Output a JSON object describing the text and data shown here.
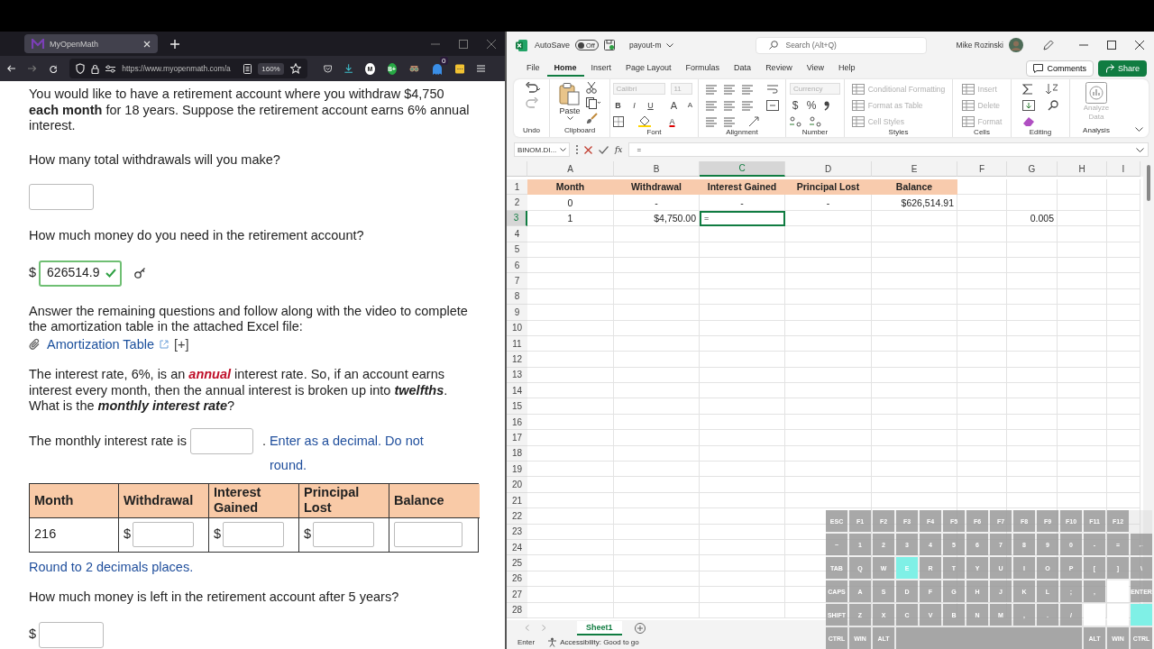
{
  "browser": {
    "tab": {
      "title": "MyOpenMath",
      "selected": true
    },
    "url": "https://www.myopenmath.com/a",
    "zoom": "160%",
    "extensions": [
      "M",
      "B+"
    ],
    "notification_count": "0"
  },
  "problem": [
    {
      "kind": "paragraph",
      "text": "You would like to have a retirement account where you withdraw $4,750 **each month** for 18 years. Suppose the retirement account earns 6% annual interest."
    },
    {
      "kind": "question",
      "text": "How many total withdrawals will you make?"
    },
    {
      "kind": "answer",
      "correct": false
    },
    {
      "kind": "question",
      "text": "How much money do you need in the retirement account?"
    },
    {
      "kind": "answer",
      "prefix": "$",
      "value": "626514.9",
      "correct": true
    },
    {
      "kind": "paragraph",
      "text": "Answer the remaining questions and follow along with the video to complete the amortization table in the attached Excel file:"
    },
    {
      "kind": "attachment",
      "link": "Amortization Table",
      "more": "[+]"
    },
    {
      "kind": "segments",
      "segments": [
        {
          "text": "The interest rate, 6%, is an ",
          "kind": "plain"
        },
        {
          "text": "annual",
          "kind": "alert"
        },
        {
          "text": " interest rate. So, if an account earns interest every month, then the annual interest is broken up into ",
          "kind": "plain"
        },
        {
          "text": "twelfths",
          "kind": "emphasis"
        },
        {
          "text": ".  What is the ",
          "kind": "plain"
        },
        {
          "text": "monthly interest rate",
          "kind": "emphasis"
        },
        {
          "text": "?",
          "kind": "plain"
        }
      ]
    },
    {
      "kind": "fill-in",
      "before": "The monthly interest rate is",
      "after": ".",
      "hint": "Enter as a decimal. Do not round."
    },
    {
      "kind": "table",
      "columns": [
        "Month",
        "Withdrawal",
        "Interest Gained",
        "Principal Lost",
        "Balance"
      ],
      "rows": [
        [
          {
            "kind": "text",
            "text": "216"
          },
          {
            "kind": "input",
            "prefix": "$"
          },
          {
            "kind": "input",
            "prefix": "$"
          },
          {
            "kind": "input",
            "prefix": "$"
          },
          {
            "kind": "input"
          }
        ]
      ]
    },
    {
      "kind": "note",
      "text": "Round to 2 decimals places."
    },
    {
      "kind": "question",
      "text": "How much money is left in the retirement account after 5 years?"
    },
    {
      "kind": "answer",
      "prefix": "$",
      "correct": false
    }
  ],
  "excel": {
    "autosave": {
      "label": "AutoSave",
      "on": false,
      "state_text": "Off"
    },
    "file_name": "payout-m",
    "search_placeholder": "Search (Alt+Q)",
    "user": "Mike Rozinski",
    "menu": [
      {
        "label": "File",
        "selected": false
      },
      {
        "label": "Home",
        "selected": true
      },
      {
        "label": "Insert",
        "selected": false
      },
      {
        "label": "Page Layout",
        "selected": false
      },
      {
        "label": "Formulas",
        "selected": false
      },
      {
        "label": "Data",
        "selected": false
      },
      {
        "label": "Review",
        "selected": false
      },
      {
        "label": "View",
        "selected": false
      },
      {
        "label": "Help",
        "selected": false
      }
    ],
    "comments": "Comments",
    "share": "Share",
    "ribbon": [
      {
        "kind": "undo",
        "label": "Undo"
      },
      {
        "kind": "clipboard",
        "label": "Clipboard",
        "items": [
          {
            "text": "Paste",
            "disabled": false
          }
        ]
      },
      {
        "kind": "font",
        "label": "Font",
        "items": [
          {
            "text": "Calibri",
            "disabled": true
          },
          {
            "text": "11",
            "disabled": true
          },
          {
            "text": "B",
            "disabled": false
          },
          {
            "text": "I",
            "disabled": false
          },
          {
            "text": "U",
            "disabled": false
          },
          {
            "text": "A",
            "disabled": false
          },
          {
            "text": "A",
            "disabled": false
          },
          {
            "text": "A",
            "disabled": false
          }
        ]
      },
      {
        "kind": "alignment",
        "label": "Alignment"
      },
      {
        "kind": "number",
        "label": "Number",
        "items": [
          {
            "text": "Currency",
            "disabled": true
          },
          {
            "text": "$",
            "disabled": false
          },
          {
            "text": "%",
            "disabled": false
          }
        ]
      },
      {
        "kind": "styles",
        "label": "Styles",
        "items": [
          {
            "text": "Conditional Formatting",
            "disabled": true
          },
          {
            "text": "Format as Table",
            "disabled": true
          },
          {
            "text": "Cell Styles",
            "disabled": true
          }
        ]
      },
      {
        "kind": "cells",
        "label": "Cells",
        "items": [
          {
            "text": "Insert",
            "disabled": true
          },
          {
            "text": "Delete",
            "disabled": true
          },
          {
            "text": "Format",
            "disabled": true
          }
        ]
      },
      {
        "kind": "editing",
        "label": "Editing"
      },
      {
        "kind": "analysis",
        "label": "Analysis",
        "items": [
          {
            "text": "Analyze Data",
            "disabled": true
          }
        ]
      }
    ],
    "name_box": "BINOM.DI...",
    "fx": "fx",
    "formula": "=",
    "columns": [
      {
        "label": "A",
        "selected": false
      },
      {
        "label": "B",
        "selected": false
      },
      {
        "label": "C",
        "selected": true
      },
      {
        "label": "D",
        "selected": false
      },
      {
        "label": "E",
        "selected": false
      },
      {
        "label": "F",
        "selected": false
      },
      {
        "label": "G",
        "selected": false
      },
      {
        "label": "H",
        "selected": false
      },
      {
        "label": "I",
        "selected": false
      }
    ],
    "rows": [
      {
        "number": "1",
        "selected": false,
        "cells": [
          {
            "kind": "header",
            "text": "Month",
            "selected": false
          },
          {
            "kind": "header",
            "text": "Withdrawal",
            "selected": false
          },
          {
            "kind": "header",
            "text": "Interest Gained",
            "selected": false
          },
          {
            "kind": "header",
            "text": "Principal Lost",
            "selected": false
          },
          {
            "kind": "header",
            "text": "Balance",
            "selected": false
          }
        ]
      },
      {
        "number": "2",
        "selected": false,
        "cells": [
          {
            "kind": "center",
            "text": "0",
            "selected": false
          },
          {
            "kind": "center",
            "text": "-",
            "selected": false
          },
          {
            "kind": "center",
            "text": "-",
            "selected": false
          },
          {
            "kind": "center",
            "text": "-",
            "selected": false
          },
          {
            "kind": "number",
            "text": "$626,514.91",
            "selected": false
          }
        ]
      },
      {
        "number": "3",
        "selected": true,
        "cells": [
          {
            "kind": "center",
            "text": "1",
            "selected": false
          },
          {
            "kind": "number",
            "text": "$4,750.00",
            "selected": false
          },
          {
            "kind": "input",
            "text": "=",
            "selected": true
          },
          {
            "kind": "empty",
            "selected": false
          },
          {
            "kind": "empty",
            "selected": false
          },
          {
            "kind": "empty",
            "selected": false
          },
          {
            "kind": "number",
            "text": "0.005",
            "selected": false
          }
        ]
      },
      {
        "number": "4",
        "selected": false
      },
      {
        "number": "5",
        "selected": false
      },
      {
        "number": "6",
        "selected": false
      },
      {
        "number": "7",
        "selected": false
      },
      {
        "number": "8",
        "selected": false
      },
      {
        "number": "9",
        "selected": false
      },
      {
        "number": "10",
        "selected": false
      },
      {
        "number": "11",
        "selected": false
      },
      {
        "number": "12",
        "selected": false
      },
      {
        "number": "13",
        "selected": false
      },
      {
        "number": "14",
        "selected": false
      },
      {
        "number": "15",
        "selected": false
      },
      {
        "number": "16",
        "selected": false
      },
      {
        "number": "17",
        "selected": false
      },
      {
        "number": "18",
        "selected": false
      },
      {
        "number": "19",
        "selected": false
      },
      {
        "number": "20",
        "selected": false
      },
      {
        "number": "21",
        "selected": false
      },
      {
        "number": "22",
        "selected": false
      },
      {
        "number": "23",
        "selected": false
      },
      {
        "number": "24",
        "selected": false
      },
      {
        "number": "25",
        "selected": false
      },
      {
        "number": "26",
        "selected": false
      },
      {
        "number": "27",
        "selected": false
      },
      {
        "number": "28",
        "selected": false
      }
    ],
    "sheets": [
      {
        "label": "Sheet1",
        "selected": true
      }
    ],
    "status": {
      "mode": "Enter",
      "accessibility": "Accessibility: Good to go"
    }
  },
  "keyboard": [
    [
      {
        "kind": "key",
        "label": "ESC",
        "selected": false
      },
      {
        "kind": "key",
        "label": "F1",
        "selected": false
      },
      {
        "kind": "key",
        "label": "F2",
        "selected": false
      },
      {
        "kind": "key",
        "label": "F3",
        "selected": false
      },
      {
        "kind": "key",
        "label": "F4",
        "selected": false
      },
      {
        "kind": "key",
        "label": "F5",
        "selected": false
      },
      {
        "kind": "key",
        "label": "F6",
        "selected": false
      },
      {
        "kind": "key",
        "label": "F7",
        "selected": false
      },
      {
        "kind": "key",
        "label": "F8",
        "selected": false
      },
      {
        "kind": "key",
        "label": "F9",
        "selected": false
      },
      {
        "kind": "key",
        "label": "F10",
        "selected": false
      },
      {
        "kind": "key",
        "label": "F11",
        "selected": false
      },
      {
        "kind": "key",
        "label": "F12",
        "selected": false
      }
    ],
    [
      {
        "kind": "key",
        "label": "~",
        "selected": false
      },
      {
        "kind": "key",
        "label": "1",
        "selected": false
      },
      {
        "kind": "key",
        "label": "2",
        "selected": false
      },
      {
        "kind": "key",
        "label": "3",
        "selected": false
      },
      {
        "kind": "key",
        "label": "4",
        "selected": false
      },
      {
        "kind": "key",
        "label": "5",
        "selected": false
      },
      {
        "kind": "key",
        "label": "6",
        "selected": false
      },
      {
        "kind": "key",
        "label": "7",
        "selected": false
      },
      {
        "kind": "key",
        "label": "8",
        "selected": false
      },
      {
        "kind": "key",
        "label": "9",
        "selected": false
      },
      {
        "kind": "key",
        "label": "0",
        "selected": false
      },
      {
        "kind": "key",
        "label": "-",
        "selected": false
      },
      {
        "kind": "key",
        "label": "=",
        "selected": false
      },
      {
        "kind": "key",
        "label": "←",
        "selected": false
      }
    ],
    [
      {
        "kind": "key",
        "label": "TAB",
        "selected": false
      },
      {
        "kind": "key",
        "label": "Q",
        "selected": false
      },
      {
        "kind": "key",
        "label": "W",
        "selected": false
      },
      {
        "kind": "key",
        "label": "E",
        "selected": true
      },
      {
        "kind": "key",
        "label": "R",
        "selected": false
      },
      {
        "kind": "key",
        "label": "T",
        "selected": false
      },
      {
        "kind": "key",
        "label": "Y",
        "selected": false
      },
      {
        "kind": "key",
        "label": "U",
        "selected": false
      },
      {
        "kind": "key",
        "label": "I",
        "selected": false
      },
      {
        "kind": "key",
        "label": "O",
        "selected": false
      },
      {
        "kind": "key",
        "label": "P",
        "selected": false
      },
      {
        "kind": "key",
        "label": "[",
        "selected": false
      },
      {
        "kind": "key",
        "label": "]",
        "selected": false
      },
      {
        "kind": "key",
        "label": "\\",
        "selected": false
      }
    ],
    [
      {
        "kind": "key",
        "label": "CAPS",
        "selected": false
      },
      {
        "kind": "key",
        "label": "A",
        "selected": false
      },
      {
        "kind": "key",
        "label": "S",
        "selected": false
      },
      {
        "kind": "key",
        "label": "D",
        "selected": false
      },
      {
        "kind": "key",
        "label": "F",
        "selected": false
      },
      {
        "kind": "key",
        "label": "G",
        "selected": false
      },
      {
        "kind": "key",
        "label": "H",
        "selected": false
      },
      {
        "kind": "key",
        "label": "J",
        "selected": false
      },
      {
        "kind": "key",
        "label": "K",
        "selected": false
      },
      {
        "kind": "key",
        "label": "L",
        "selected": false
      },
      {
        "kind": "key",
        "label": ";",
        "selected": false
      },
      {
        "kind": "key",
        "label": ",",
        "selected": false
      },
      {
        "kind": "blank",
        "selected": false
      },
      {
        "kind": "key",
        "label": "ENTER",
        "selected": false
      }
    ],
    [
      {
        "kind": "key",
        "label": "SHIFT",
        "selected": false
      },
      {
        "kind": "key",
        "label": "Z",
        "selected": false
      },
      {
        "kind": "key",
        "label": "X",
        "selected": false
      },
      {
        "kind": "key",
        "label": "C",
        "selected": false
      },
      {
        "kind": "key",
        "label": "V",
        "selected": false
      },
      {
        "kind": "key",
        "label": "B",
        "selected": false
      },
      {
        "kind": "key",
        "label": "N",
        "selected": false
      },
      {
        "kind": "key",
        "label": "M",
        "selected": false
      },
      {
        "kind": "key",
        "label": ",",
        "selected": false
      },
      {
        "kind": "key",
        "label": ".",
        "selected": false
      },
      {
        "kind": "key",
        "label": "/",
        "selected": false
      },
      {
        "kind": "blank",
        "selected": false
      },
      {
        "kind": "blank",
        "selected": false
      },
      {
        "kind": "blank",
        "selected": true
      }
    ],
    [
      {
        "kind": "key",
        "label": "CTRL",
        "selected": false
      },
      {
        "kind": "key",
        "label": "WIN",
        "selected": false
      },
      {
        "kind": "key",
        "label": "ALT",
        "selected": false
      },
      {
        "kind": "space",
        "selected": false
      },
      {
        "kind": "key",
        "label": "ALT",
        "selected": false
      },
      {
        "kind": "key",
        "label": "WIN",
        "selected": false
      },
      {
        "kind": "key",
        "label": "CTRL",
        "selected": false
      }
    ]
  ]
}
